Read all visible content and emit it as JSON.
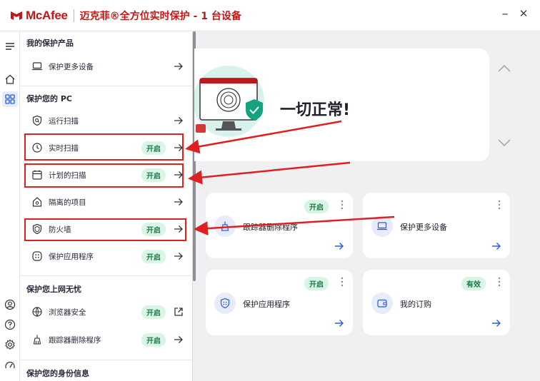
{
  "titlebar": {
    "brand": "McAfee",
    "title": "迈克菲®全方位实时保护 - 1 台设备",
    "minimize": "–",
    "close": "✕"
  },
  "drawer": {
    "section1_title": "我的保护产品",
    "protect_more_devices": "保护更多设备",
    "section2_title": "保护您的 PC",
    "run_scan": "运行扫描",
    "realtime_scan": "实时扫描",
    "scheduled_scan": "计划的扫描",
    "quarantined": "隔离的项目",
    "firewall": "防火墙",
    "app_protect": "保护应用程序",
    "section3_title": "保护您上网无忧",
    "browser_security": "浏览器安全",
    "tracker_remover": "跟踪器删除程序",
    "section4_title": "保护您的身份信息",
    "on_badge": "开启"
  },
  "hero": {
    "status": "一切正常!"
  },
  "cards": {
    "tracker_label": "跟踪器删除程序",
    "tracker_badge": "开启",
    "more_devices_label": "保护更多设备",
    "app_protect_label": "保护应用程序",
    "app_protect_badge": "开启",
    "subscription_label": "我的订购",
    "subscription_badge": "有效"
  },
  "colors": {
    "brand_red": "#c01818",
    "badge_bg": "#d8f5e6",
    "badge_text": "#1a7a48",
    "annotation_red": "#e02020"
  }
}
